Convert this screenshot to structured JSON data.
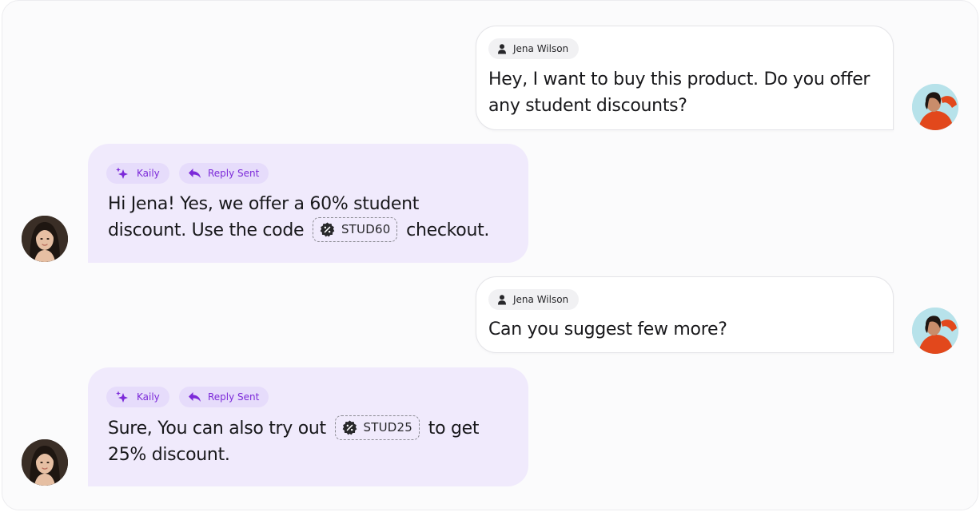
{
  "conversation": {
    "messages": [
      {
        "role": "user",
        "sender": "Jena Wilson",
        "lines": [
          "Hey, I want to buy this product. Do you offer",
          "any student discounts?"
        ]
      },
      {
        "role": "bot",
        "sender": "Kaily",
        "status": "Reply Sent",
        "line1": "Hi Jena! Yes, we offer a 60% student",
        "line2_before": "discount. Use the code",
        "code": "STUD60",
        "line2_after": "checkout."
      },
      {
        "role": "user",
        "sender": "Jena Wilson",
        "lines": [
          "Can you suggest few more?"
        ]
      },
      {
        "role": "bot",
        "sender": "Kaily",
        "status": "Reply Sent",
        "line1_before": "Sure, You can also try out",
        "code": "STUD25",
        "line1_after": "to get",
        "line2": "25% discount."
      }
    ]
  },
  "colors": {
    "bot_bubble": "#f0eafc",
    "bot_chip": "#e6dcfb",
    "bot_accent": "#7c2ad9",
    "user_bubble": "#ffffff",
    "user_chip": "#f1f1f3",
    "background": "#fbfbfc"
  },
  "icons": {
    "user_chip": "person-icon",
    "bot_chip": "sparkle-icon",
    "status_chip": "reply-arrow-icon",
    "code": "discount-badge-icon"
  }
}
